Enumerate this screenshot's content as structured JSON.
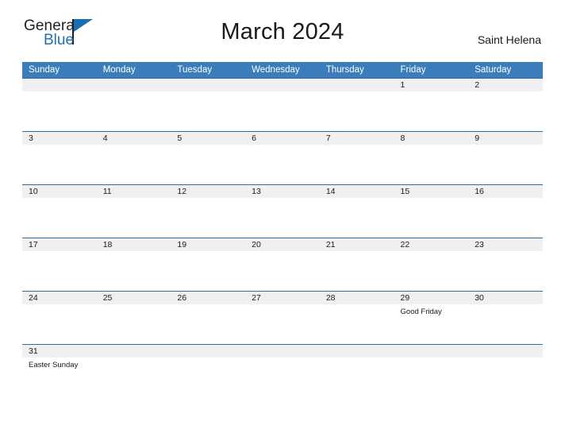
{
  "logo": {
    "word_one": "General",
    "word_two": "Blue",
    "flag_icon": "blue-triangle-flag-icon",
    "brand_blue": "#1f6fb5"
  },
  "header": {
    "title": "March 2024",
    "region": "Saint Helena"
  },
  "colors": {
    "header_blue": "#3b7cba",
    "divider_blue": "#2e6da4",
    "daynum_gray": "#f0f0f0",
    "text": "#1a1a1a"
  },
  "calendar": {
    "weekdays": [
      "Sunday",
      "Monday",
      "Tuesday",
      "Wednesday",
      "Thursday",
      "Friday",
      "Saturday"
    ],
    "weeks": [
      [
        {
          "day": "",
          "events": []
        },
        {
          "day": "",
          "events": []
        },
        {
          "day": "",
          "events": []
        },
        {
          "day": "",
          "events": []
        },
        {
          "day": "",
          "events": []
        },
        {
          "day": "1",
          "events": []
        },
        {
          "day": "2",
          "events": []
        }
      ],
      [
        {
          "day": "3",
          "events": []
        },
        {
          "day": "4",
          "events": []
        },
        {
          "day": "5",
          "events": []
        },
        {
          "day": "6",
          "events": []
        },
        {
          "day": "7",
          "events": []
        },
        {
          "day": "8",
          "events": []
        },
        {
          "day": "9",
          "events": []
        }
      ],
      [
        {
          "day": "10",
          "events": []
        },
        {
          "day": "11",
          "events": []
        },
        {
          "day": "12",
          "events": []
        },
        {
          "day": "13",
          "events": []
        },
        {
          "day": "14",
          "events": []
        },
        {
          "day": "15",
          "events": []
        },
        {
          "day": "16",
          "events": []
        }
      ],
      [
        {
          "day": "17",
          "events": []
        },
        {
          "day": "18",
          "events": []
        },
        {
          "day": "19",
          "events": []
        },
        {
          "day": "20",
          "events": []
        },
        {
          "day": "21",
          "events": []
        },
        {
          "day": "22",
          "events": []
        },
        {
          "day": "23",
          "events": []
        }
      ],
      [
        {
          "day": "24",
          "events": []
        },
        {
          "day": "25",
          "events": []
        },
        {
          "day": "26",
          "events": []
        },
        {
          "day": "27",
          "events": []
        },
        {
          "day": "28",
          "events": []
        },
        {
          "day": "29",
          "events": [
            "Good Friday"
          ]
        },
        {
          "day": "30",
          "events": []
        }
      ],
      [
        {
          "day": "31",
          "events": [
            "Easter Sunday"
          ]
        },
        {
          "day": "",
          "events": []
        },
        {
          "day": "",
          "events": []
        },
        {
          "day": "",
          "events": []
        },
        {
          "day": "",
          "events": []
        },
        {
          "day": "",
          "events": []
        },
        {
          "day": "",
          "events": []
        }
      ]
    ]
  }
}
